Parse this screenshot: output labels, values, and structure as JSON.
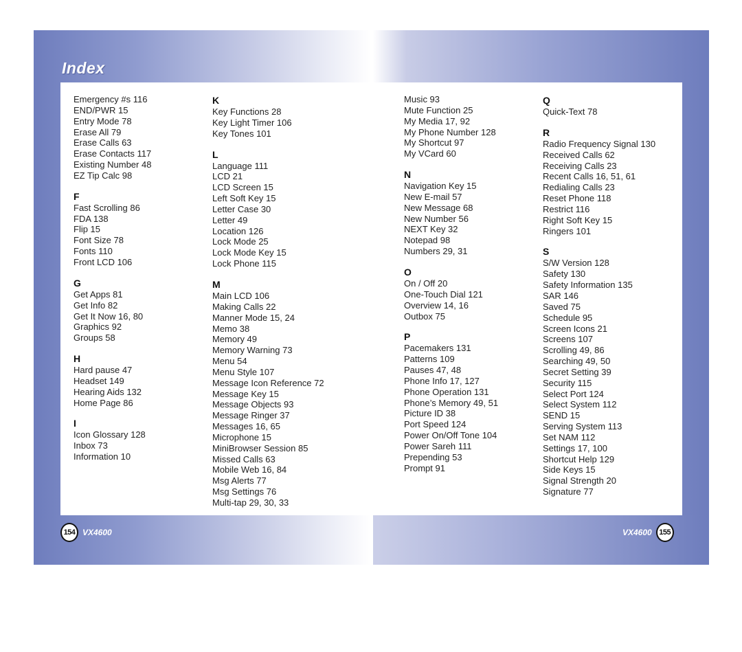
{
  "header": {
    "title": "Index"
  },
  "columns": [
    {
      "sections": [
        {
          "letter": "",
          "entries": [
            "Emergency #s 116",
            "END/PWR 15",
            "Entry Mode 78",
            "Erase All 79",
            "Erase Calls 63",
            "Erase Contacts 117",
            "Existing Number 48",
            "EZ Tip Calc 98"
          ]
        },
        {
          "letter": "F",
          "entries": [
            "Fast Scrolling 86",
            "FDA 138",
            "Flip 15",
            "Font Size 78",
            "Fonts 110",
            "Front LCD 106"
          ]
        },
        {
          "letter": "G",
          "entries": [
            "Get Apps 81",
            "Get Info 82",
            "Get It Now 16, 80",
            "Graphics 92",
            "Groups 58"
          ]
        },
        {
          "letter": "H",
          "entries": [
            "Hard pause 47",
            "Headset 149",
            "Hearing Aids 132",
            "Home Page 86"
          ]
        },
        {
          "letter": "I",
          "entries": [
            "Icon Glossary 128",
            "Inbox 73",
            "Information 10"
          ]
        }
      ]
    },
    {
      "sections": [
        {
          "letter": "K",
          "entries": [
            "Key Functions 28",
            "Key Light Timer 106",
            "Key Tones 101"
          ]
        },
        {
          "letter": "L",
          "entries": [
            "Language 111",
            "LCD 21",
            "LCD Screen 15",
            "Left Soft Key 15",
            "Letter Case 30",
            "Letter 49",
            "Location 126",
            "Lock Mode 25",
            "Lock Mode Key 15",
            "Lock Phone 115"
          ]
        },
        {
          "letter": "M",
          "entries": [
            "Main LCD 106",
            "Making Calls 22",
            "Manner Mode 15, 24",
            "Memo 38",
            "Memory 49",
            "Memory Warning 73",
            "Menu 54",
            "Menu Style 107",
            "Message Icon Reference 72",
            "Message Key 15",
            "Message Objects 93",
            "Message Ringer 37",
            "Messages 16, 65",
            "Microphone 15",
            "MiniBrowser Session 85",
            "Missed Calls 63",
            "Mobile Web 16, 84",
            "Msg Alerts 77",
            "Msg Settings 76",
            "Multi-tap 29, 30, 33"
          ]
        }
      ]
    },
    {
      "sections": [
        {
          "letter": "",
          "entries": [
            "Music 93",
            "Mute Function 25",
            "My Media 17, 92",
            "My Phone Number 128",
            "My Shortcut 97",
            "My VCard 60"
          ]
        },
        {
          "letter": "N",
          "entries": [
            "Navigation Key 15",
            "New E-mail 57",
            "New Message 68",
            "New Number 56",
            "NEXT Key 32",
            "Notepad 98",
            "Numbers 29, 31"
          ]
        },
        {
          "letter": "O",
          "entries": [
            "On / Off 20",
            "One-Touch Dial 121",
            "Overview 14, 16",
            "Outbox 75"
          ]
        },
        {
          "letter": "P",
          "entries": [
            "Pacemakers 131",
            "Patterns 109",
            "Pauses 47, 48",
            "Phone Info 17, 127",
            "Phone Operation 131",
            "Phone’s Memory 49, 51",
            "Picture ID 38",
            "Port Speed 124",
            "Power On/Off Tone 104",
            "Power Sareh 111",
            "Prepending 53",
            "Prompt 91"
          ]
        }
      ]
    },
    {
      "sections": [
        {
          "letter": "Q",
          "entries": [
            "Quick-Text 78"
          ]
        },
        {
          "letter": "R",
          "entries": [
            "Radio Frequency Signal 130",
            "Received Calls 62",
            "Receiving Calls 23",
            "Recent Calls 16, 51, 61",
            "Redialing Calls 23",
            "Reset Phone 118",
            "Restrict 116",
            "Right Soft Key 15",
            "Ringers 101"
          ]
        },
        {
          "letter": "S",
          "entries": [
            "S/W Version 128",
            "Safety 130",
            "Safety Information 135",
            "SAR 146",
            "Saved 75",
            "Schedule 95",
            "Screen Icons 21",
            "Screens 107",
            "Scrolling 49, 86",
            "Searching 49, 50",
            "Secret Setting 39",
            "Security 115",
            "Select Port 124",
            "Select System 112",
            "SEND 15",
            "Serving System 113",
            "Set NAM 112",
            "Settings 17, 100",
            "Shortcut Help 129",
            "Side Keys 15",
            "Signal Strength 20",
            "Signature 77"
          ]
        }
      ]
    }
  ],
  "footer": {
    "left": {
      "page": "154",
      "model": "VX4600"
    },
    "right": {
      "page": "155",
      "model": "VX4600"
    }
  }
}
